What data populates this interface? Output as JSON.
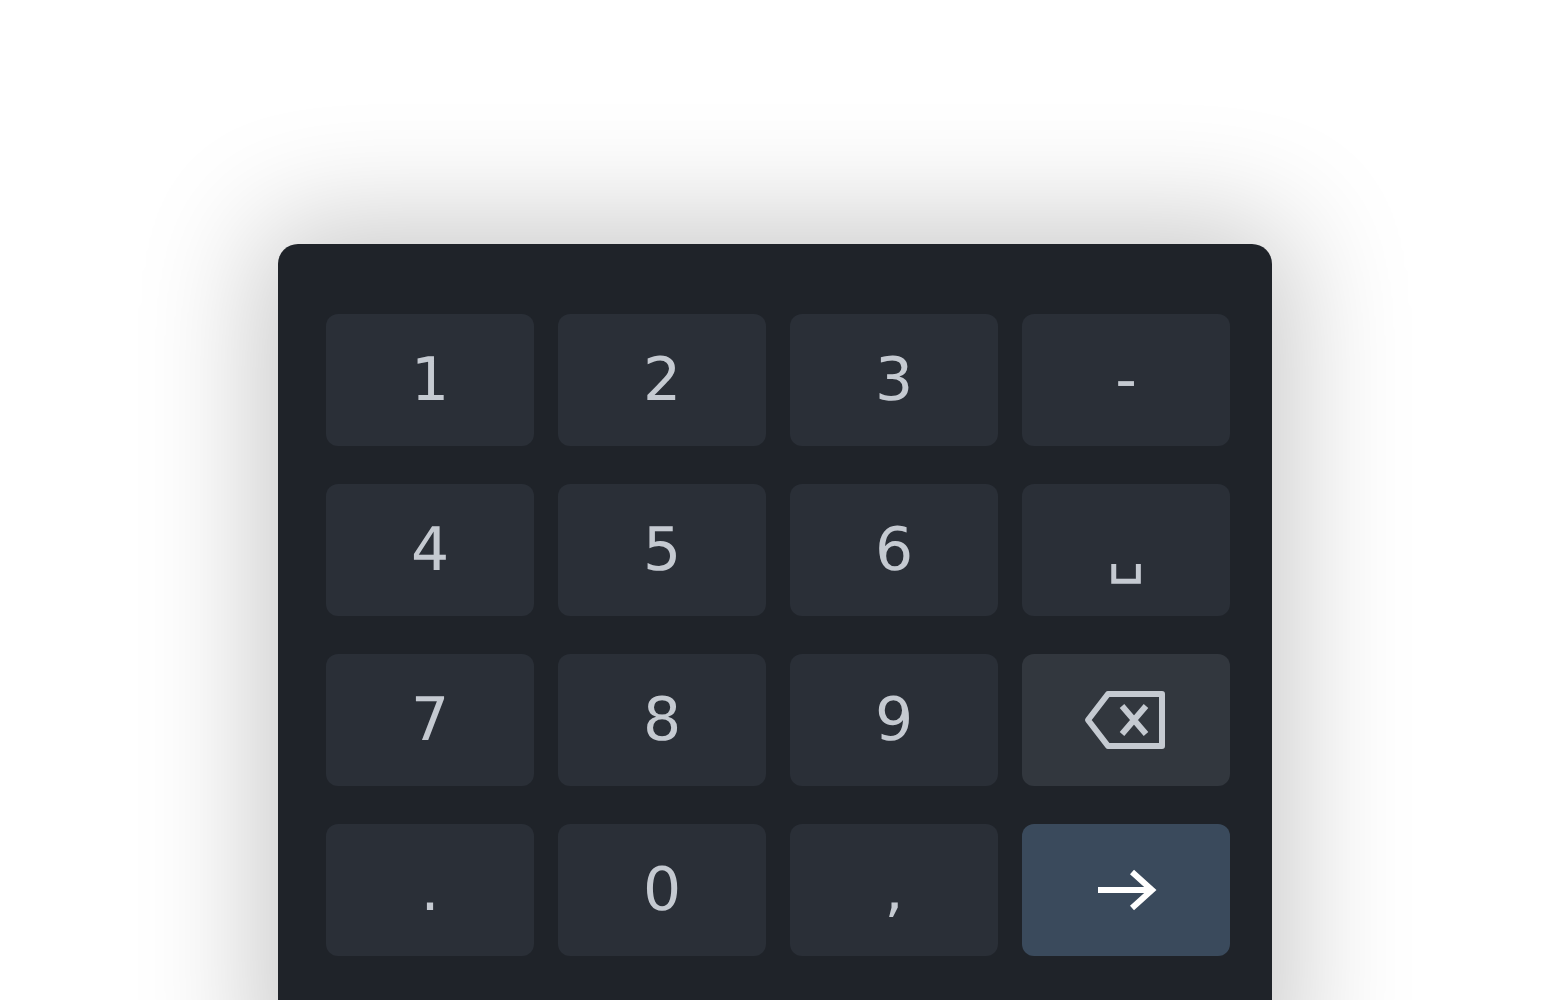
{
  "keypad": {
    "keys": [
      {
        "kind": "char",
        "label": "1"
      },
      {
        "kind": "char",
        "label": "2"
      },
      {
        "kind": "char",
        "label": "3"
      },
      {
        "kind": "char",
        "label": "-"
      },
      {
        "kind": "char",
        "label": "4"
      },
      {
        "kind": "char",
        "label": "5"
      },
      {
        "kind": "char",
        "label": "6"
      },
      {
        "kind": "char",
        "label": "␣"
      },
      {
        "kind": "char",
        "label": "7"
      },
      {
        "kind": "char",
        "label": "8"
      },
      {
        "kind": "char",
        "label": "9"
      },
      {
        "kind": "backspace"
      },
      {
        "kind": "char",
        "label": "."
      },
      {
        "kind": "char",
        "label": "0"
      },
      {
        "kind": "char",
        "label": ","
      },
      {
        "kind": "enter"
      }
    ]
  }
}
